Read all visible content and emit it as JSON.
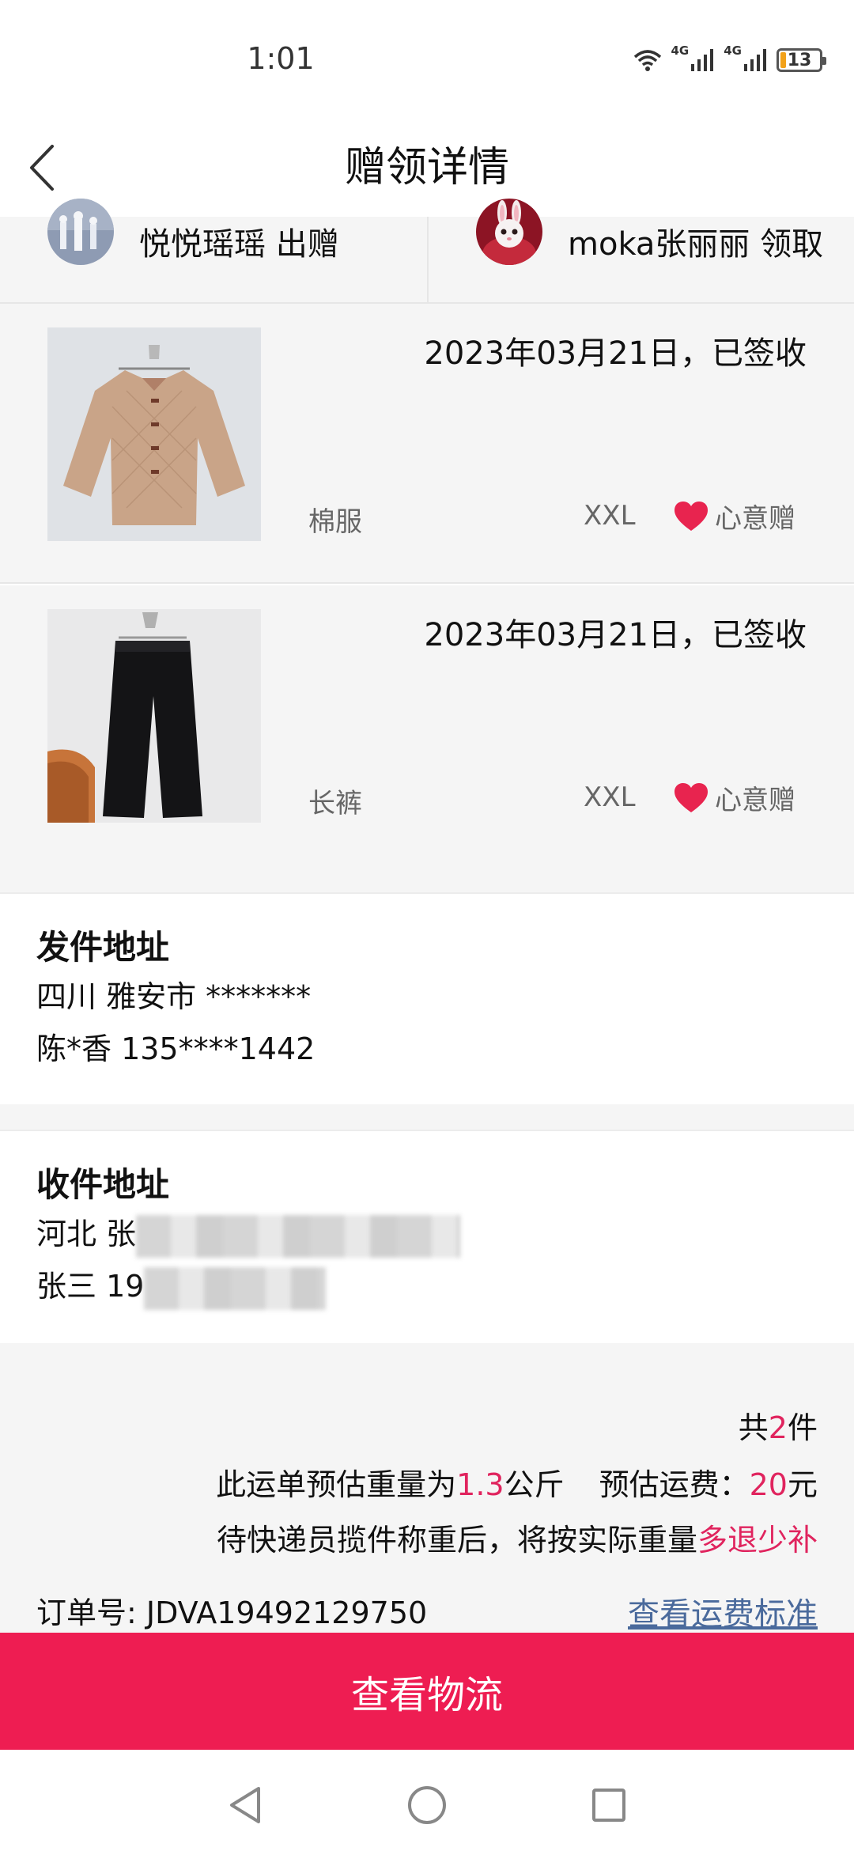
{
  "status": {
    "time": "1:01",
    "net1": "4G",
    "net2": "4G",
    "battery": "13"
  },
  "header": {
    "title": "赠领详情"
  },
  "users": {
    "giver": {
      "label": "悦悦瑶瑶 出赠"
    },
    "receiver": {
      "label": "moka张丽丽 领取"
    }
  },
  "items": [
    {
      "date": "2023年03月21日，已签收",
      "name": "棉服",
      "size": "XXL",
      "tag": "心意赠"
    },
    {
      "date": "2023年03月21日，已签收",
      "name": "长裤",
      "size": "XXL",
      "tag": "心意赠"
    }
  ],
  "sender": {
    "title": "发件地址",
    "address": "四川 雅安市 *******",
    "contact": "陈*香 135****1442"
  },
  "recipient": {
    "title": "收件地址",
    "address_prefix": "河北 张",
    "contact_prefix": "张三 19"
  },
  "summary": {
    "count_prefix": "共",
    "count": "2",
    "count_suffix": "件",
    "weight_prefix": "此运单预估重量为",
    "weight": "1.3",
    "weight_unit": "公斤",
    "fee_prefix": "预估运费：",
    "fee": "20",
    "fee_unit": "元",
    "note_prefix": "待快递员揽件称重后，将按实际重量",
    "note_highlight": "多退少补",
    "order_label": "订单号: JDVA19492129750",
    "fee_link": "查看运费标准"
  },
  "actions": {
    "logistics": "查看物流"
  },
  "colors": {
    "accent": "#ee1d52",
    "highlight": "#e0245e",
    "link": "#4a6a9c",
    "heart": "#e8244f"
  }
}
